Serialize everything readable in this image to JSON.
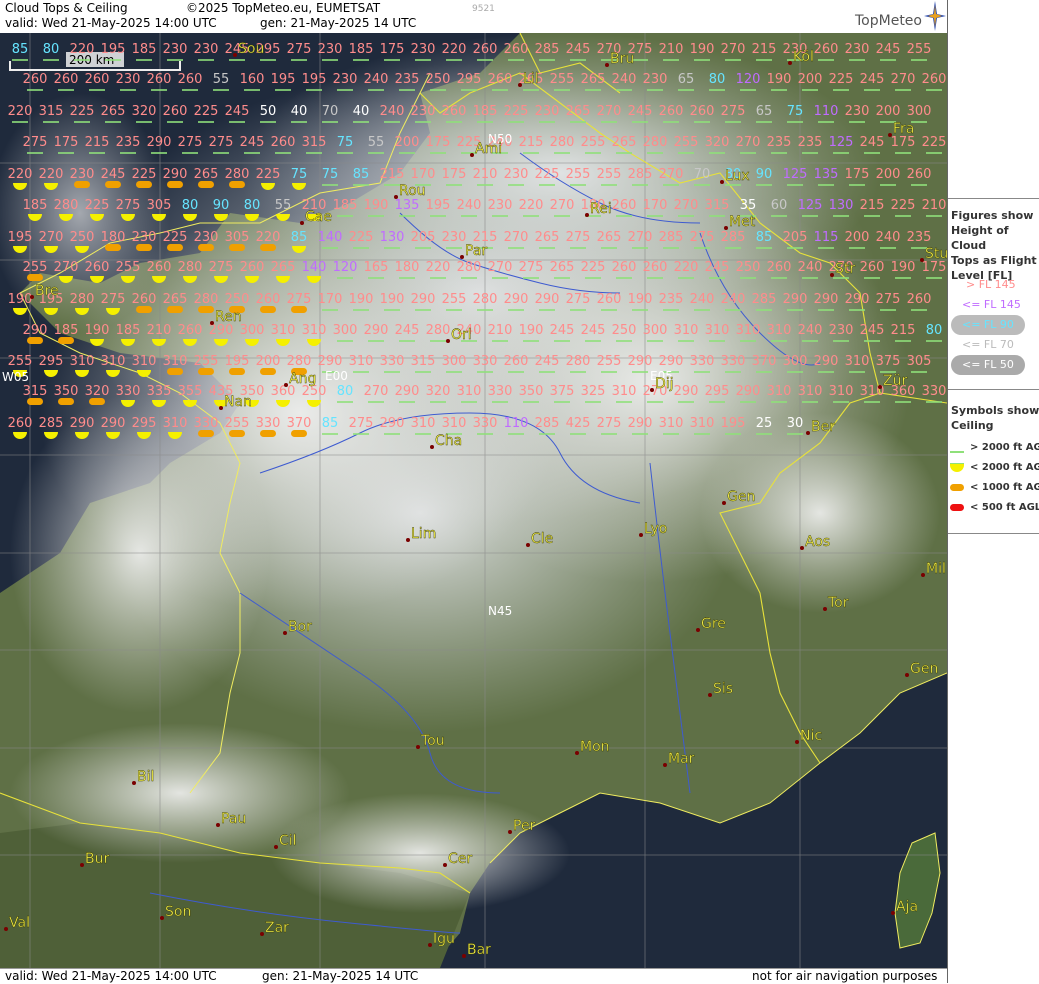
{
  "header": {
    "title": "Cloud Tops & Ceiling",
    "copyright": "©2025 TopMeteo.eu, EUMETSAT",
    "valid": "valid:  Wed  21-May-2025  14:00 UTC",
    "gen": "gen: 21-May-2025 14 UTC",
    "code": "9521",
    "brand": "TopMeteo"
  },
  "footer": {
    "valid": "valid:  Wed  21-May-2025  14:00 UTC",
    "gen": "gen:  21-May-2025  14 UTC",
    "disclaimer": "not for air navigation purposes"
  },
  "scale_label": "200 km",
  "legend": {
    "title": [
      "Figures show",
      "Height of Cloud",
      "Tops as Flight",
      "Level  [FL]"
    ],
    "items": [
      {
        "label": "> FL 145",
        "color": "#ff8c8c"
      },
      {
        "label": "<= FL 145",
        "color": "#c06cff"
      },
      {
        "label": "<= FL 90",
        "color": "#66e4ff"
      },
      {
        "label": "<= FL 70",
        "color": "#bbbbbb"
      },
      {
        "label": "<= FL 50",
        "color": "#ffffff"
      }
    ],
    "symbols_title": [
      "Symbols show",
      "Ceiling"
    ],
    "symbols": [
      {
        "label": "> 2000 ft AGL",
        "shape": "green-line"
      },
      {
        "label": "< 2000 ft AGL",
        "shape": "yellow-half-disc"
      },
      {
        "label": "< 1000 ft AGL",
        "shape": "orange-pill"
      },
      {
        "label": "< 500 ft AGL",
        "shape": "red-pill"
      }
    ]
  },
  "cities": [
    "Sou",
    "Bru",
    "Köl",
    "Lil",
    "Fra",
    "Ami",
    "Lux",
    "Rou",
    "Cae",
    "Rei",
    "Met",
    "Par",
    "Str",
    "Stu",
    "Bre",
    "Ren",
    "Orl",
    "Zür",
    "Nan",
    "Ang",
    "Dij",
    "Ber",
    "Cha",
    "Gen",
    "Lim",
    "Cle",
    "Lyo",
    "Aos",
    "Mil",
    "Gre",
    "Tor",
    "Bor",
    "Gen",
    "Sis",
    "Nic",
    "Mon",
    "Tou",
    "Mar",
    "Bil",
    "Pau",
    "Per",
    "Cer",
    "Bur",
    "Cil",
    "Son",
    "Zar",
    "Val",
    "Igu",
    "Bar",
    "Aja"
  ],
  "grid_labels": [
    "N50",
    "E00",
    "E05",
    "W05",
    "N45"
  ],
  "values": [
    "85",
    "80",
    "220",
    "195",
    "185",
    "230",
    "230",
    "245",
    "295",
    "275",
    "230",
    "185",
    "175",
    "230",
    "220",
    "260",
    "260",
    "285",
    "245",
    "270",
    "275",
    "210",
    "190",
    "270",
    "215",
    "230",
    "260",
    "230",
    "245",
    "255",
    "260",
    "260",
    "260",
    "230",
    "260",
    "260",
    "55",
    "160",
    "195",
    "195",
    "230",
    "240",
    "235",
    "250",
    "295",
    "260",
    "265",
    "255",
    "265",
    "240",
    "230",
    "65",
    "80",
    "120",
    "190",
    "200",
    "225",
    "245",
    "270",
    "260",
    "220",
    "315",
    "225",
    "265",
    "320",
    "260",
    "225",
    "245",
    "50",
    "40",
    "70",
    "40",
    "240",
    "230",
    "260",
    "185",
    "225",
    "230",
    "265",
    "270",
    "245",
    "260",
    "260",
    "275",
    "65",
    "75",
    "110",
    "230",
    "200",
    "300",
    "275",
    "175",
    "215",
    "235",
    "290",
    "275",
    "275",
    "245",
    "260",
    "315",
    "75",
    "55",
    "200",
    "175",
    "225",
    "240",
    "215",
    "280",
    "255",
    "265",
    "280",
    "255",
    "320",
    "270",
    "235",
    "235",
    "125",
    "245",
    "175",
    "225",
    "220",
    "220",
    "230",
    "245",
    "225",
    "290",
    "265",
    "280",
    "225",
    "75",
    "75",
    "85",
    "215",
    "170",
    "175",
    "210",
    "230",
    "225",
    "255",
    "255",
    "285",
    "270",
    "70",
    "80",
    "90",
    "125",
    "135",
    "175",
    "200",
    "260",
    "185",
    "280",
    "225",
    "275",
    "305",
    "80",
    "90",
    "80",
    "55",
    "210",
    "185",
    "190",
    "135",
    "195",
    "240",
    "230",
    "220",
    "270",
    "180",
    "260",
    "170",
    "270",
    "315",
    "35",
    "60",
    "125",
    "130",
    "215",
    "225",
    "210",
    "195",
    "270",
    "250",
    "180",
    "230",
    "225",
    "230",
    "305",
    "220",
    "85",
    "140",
    "225",
    "130",
    "205",
    "230",
    "215",
    "270",
    "265",
    "275",
    "265",
    "270",
    "285",
    "275",
    "285",
    "85",
    "205",
    "115",
    "200",
    "240",
    "235",
    "255",
    "270",
    "260",
    "255",
    "260",
    "280",
    "275",
    "260",
    "265",
    "140",
    "120",
    "165",
    "180",
    "220",
    "280",
    "270",
    "275",
    "265",
    "225",
    "260",
    "260",
    "220",
    "245",
    "250",
    "260",
    "240",
    "270",
    "260",
    "190",
    "175",
    "190",
    "195",
    "280",
    "275",
    "260",
    "265",
    "280",
    "250",
    "260",
    "275",
    "170",
    "190",
    "190",
    "290",
    "255",
    "280",
    "290",
    "290",
    "275",
    "260",
    "190",
    "235",
    "240",
    "240",
    "285",
    "290",
    "290",
    "290",
    "275",
    "260",
    "290",
    "185",
    "190",
    "185",
    "210",
    "260",
    "290",
    "300",
    "310",
    "310",
    "300",
    "290",
    "245",
    "280",
    "240",
    "210",
    "190",
    "245",
    "245",
    "250",
    "300",
    "310",
    "310",
    "310",
    "310",
    "240",
    "230",
    "245",
    "215",
    "80",
    "255",
    "295",
    "310",
    "310",
    "310",
    "310",
    "255",
    "195",
    "200",
    "280",
    "290",
    "310",
    "330",
    "315",
    "300",
    "330",
    "260",
    "245",
    "280",
    "255",
    "290",
    "290",
    "330",
    "330",
    "370",
    "300",
    "290",
    "310",
    "375",
    "305",
    "315",
    "350",
    "320",
    "330",
    "335",
    "355",
    "435",
    "350",
    "360",
    "250",
    "80",
    "270",
    "290",
    "320",
    "310",
    "330",
    "350",
    "375",
    "325",
    "310",
    "270",
    "290",
    "295",
    "290",
    "310",
    "310",
    "310",
    "310",
    "360",
    "330",
    "260",
    "285",
    "290",
    "290",
    "295",
    "310",
    "330",
    "255",
    "330",
    "370",
    "85",
    "275",
    "290",
    "310",
    "310",
    "330",
    "110",
    "285",
    "425",
    "275",
    "290",
    "310",
    "310",
    "195",
    "25",
    "30"
  ]
}
